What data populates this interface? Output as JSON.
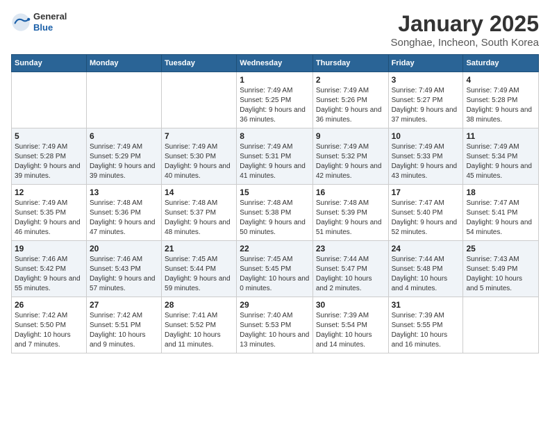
{
  "header": {
    "logo": {
      "general": "General",
      "blue": "Blue"
    },
    "title": "January 2025",
    "location": "Songhae, Incheon, South Korea"
  },
  "days_of_week": [
    "Sunday",
    "Monday",
    "Tuesday",
    "Wednesday",
    "Thursday",
    "Friday",
    "Saturday"
  ],
  "weeks": [
    [
      {
        "day": "",
        "info": ""
      },
      {
        "day": "",
        "info": ""
      },
      {
        "day": "",
        "info": ""
      },
      {
        "day": "1",
        "info": "Sunrise: 7:49 AM\nSunset: 5:25 PM\nDaylight: 9 hours and 36 minutes."
      },
      {
        "day": "2",
        "info": "Sunrise: 7:49 AM\nSunset: 5:26 PM\nDaylight: 9 hours and 36 minutes."
      },
      {
        "day": "3",
        "info": "Sunrise: 7:49 AM\nSunset: 5:27 PM\nDaylight: 9 hours and 37 minutes."
      },
      {
        "day": "4",
        "info": "Sunrise: 7:49 AM\nSunset: 5:28 PM\nDaylight: 9 hours and 38 minutes."
      }
    ],
    [
      {
        "day": "5",
        "info": "Sunrise: 7:49 AM\nSunset: 5:28 PM\nDaylight: 9 hours and 39 minutes."
      },
      {
        "day": "6",
        "info": "Sunrise: 7:49 AM\nSunset: 5:29 PM\nDaylight: 9 hours and 39 minutes."
      },
      {
        "day": "7",
        "info": "Sunrise: 7:49 AM\nSunset: 5:30 PM\nDaylight: 9 hours and 40 minutes."
      },
      {
        "day": "8",
        "info": "Sunrise: 7:49 AM\nSunset: 5:31 PM\nDaylight: 9 hours and 41 minutes."
      },
      {
        "day": "9",
        "info": "Sunrise: 7:49 AM\nSunset: 5:32 PM\nDaylight: 9 hours and 42 minutes."
      },
      {
        "day": "10",
        "info": "Sunrise: 7:49 AM\nSunset: 5:33 PM\nDaylight: 9 hours and 43 minutes."
      },
      {
        "day": "11",
        "info": "Sunrise: 7:49 AM\nSunset: 5:34 PM\nDaylight: 9 hours and 45 minutes."
      }
    ],
    [
      {
        "day": "12",
        "info": "Sunrise: 7:49 AM\nSunset: 5:35 PM\nDaylight: 9 hours and 46 minutes."
      },
      {
        "day": "13",
        "info": "Sunrise: 7:48 AM\nSunset: 5:36 PM\nDaylight: 9 hours and 47 minutes."
      },
      {
        "day": "14",
        "info": "Sunrise: 7:48 AM\nSunset: 5:37 PM\nDaylight: 9 hours and 48 minutes."
      },
      {
        "day": "15",
        "info": "Sunrise: 7:48 AM\nSunset: 5:38 PM\nDaylight: 9 hours and 50 minutes."
      },
      {
        "day": "16",
        "info": "Sunrise: 7:48 AM\nSunset: 5:39 PM\nDaylight: 9 hours and 51 minutes."
      },
      {
        "day": "17",
        "info": "Sunrise: 7:47 AM\nSunset: 5:40 PM\nDaylight: 9 hours and 52 minutes."
      },
      {
        "day": "18",
        "info": "Sunrise: 7:47 AM\nSunset: 5:41 PM\nDaylight: 9 hours and 54 minutes."
      }
    ],
    [
      {
        "day": "19",
        "info": "Sunrise: 7:46 AM\nSunset: 5:42 PM\nDaylight: 9 hours and 55 minutes."
      },
      {
        "day": "20",
        "info": "Sunrise: 7:46 AM\nSunset: 5:43 PM\nDaylight: 9 hours and 57 minutes."
      },
      {
        "day": "21",
        "info": "Sunrise: 7:45 AM\nSunset: 5:44 PM\nDaylight: 9 hours and 59 minutes."
      },
      {
        "day": "22",
        "info": "Sunrise: 7:45 AM\nSunset: 5:45 PM\nDaylight: 10 hours and 0 minutes."
      },
      {
        "day": "23",
        "info": "Sunrise: 7:44 AM\nSunset: 5:47 PM\nDaylight: 10 hours and 2 minutes."
      },
      {
        "day": "24",
        "info": "Sunrise: 7:44 AM\nSunset: 5:48 PM\nDaylight: 10 hours and 4 minutes."
      },
      {
        "day": "25",
        "info": "Sunrise: 7:43 AM\nSunset: 5:49 PM\nDaylight: 10 hours and 5 minutes."
      }
    ],
    [
      {
        "day": "26",
        "info": "Sunrise: 7:42 AM\nSunset: 5:50 PM\nDaylight: 10 hours and 7 minutes."
      },
      {
        "day": "27",
        "info": "Sunrise: 7:42 AM\nSunset: 5:51 PM\nDaylight: 10 hours and 9 minutes."
      },
      {
        "day": "28",
        "info": "Sunrise: 7:41 AM\nSunset: 5:52 PM\nDaylight: 10 hours and 11 minutes."
      },
      {
        "day": "29",
        "info": "Sunrise: 7:40 AM\nSunset: 5:53 PM\nDaylight: 10 hours and 13 minutes."
      },
      {
        "day": "30",
        "info": "Sunrise: 7:39 AM\nSunset: 5:54 PM\nDaylight: 10 hours and 14 minutes."
      },
      {
        "day": "31",
        "info": "Sunrise: 7:39 AM\nSunset: 5:55 PM\nDaylight: 10 hours and 16 minutes."
      },
      {
        "day": "",
        "info": ""
      }
    ]
  ]
}
